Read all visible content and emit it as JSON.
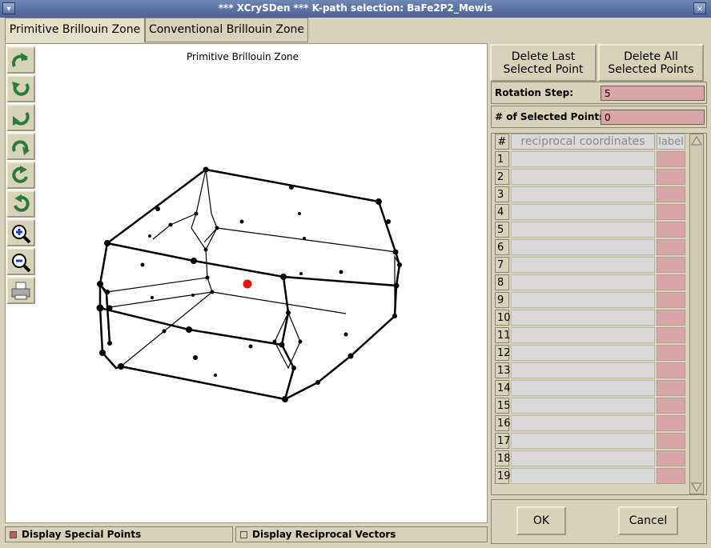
{
  "window": {
    "title": "*** XCrySDen *** K-path selection: BaFe2P2_Mewis"
  },
  "tabs": [
    {
      "label": "Primitive Brillouin Zone"
    },
    {
      "label": "Conventional Brillouin Zone"
    }
  ],
  "canvas": {
    "label": "Primitive Brillouin Zone"
  },
  "toolbar": {
    "icons": [
      "rotate-up-icon",
      "rotate-right-icon",
      "rotate-down-icon",
      "rotate-left-icon",
      "rotate-cw-icon",
      "rotate-ccw-icon",
      "zoom-in-icon",
      "zoom-out-icon",
      "print-icon"
    ]
  },
  "controls": {
    "delete_last": "Delete Last\nSelected Point",
    "delete_all": "Delete All\nSelected Points",
    "rotation_step_label": "Rotation Step:",
    "rotation_step_value": "5",
    "selected_points_label": "# of Selected Points:",
    "selected_points_value": "0"
  },
  "table": {
    "header_num": "#",
    "header_coords": "reciprocal coordinates",
    "header_label": "label",
    "rows": [
      "1",
      "2",
      "3",
      "4",
      "5",
      "6",
      "7",
      "8",
      "9",
      "10",
      "11",
      "12",
      "13",
      "14",
      "15",
      "16",
      "17",
      "18",
      "19"
    ]
  },
  "bottom": {
    "display_special_points": "Display Special Points",
    "display_reciprocal_vectors": "Display Reciprocal Vectors"
  },
  "buttons": {
    "ok": "OK",
    "cancel": "Cancel"
  },
  "colors": {
    "accent_field": "#d8a6a6",
    "selected_point": "#ee1111"
  }
}
